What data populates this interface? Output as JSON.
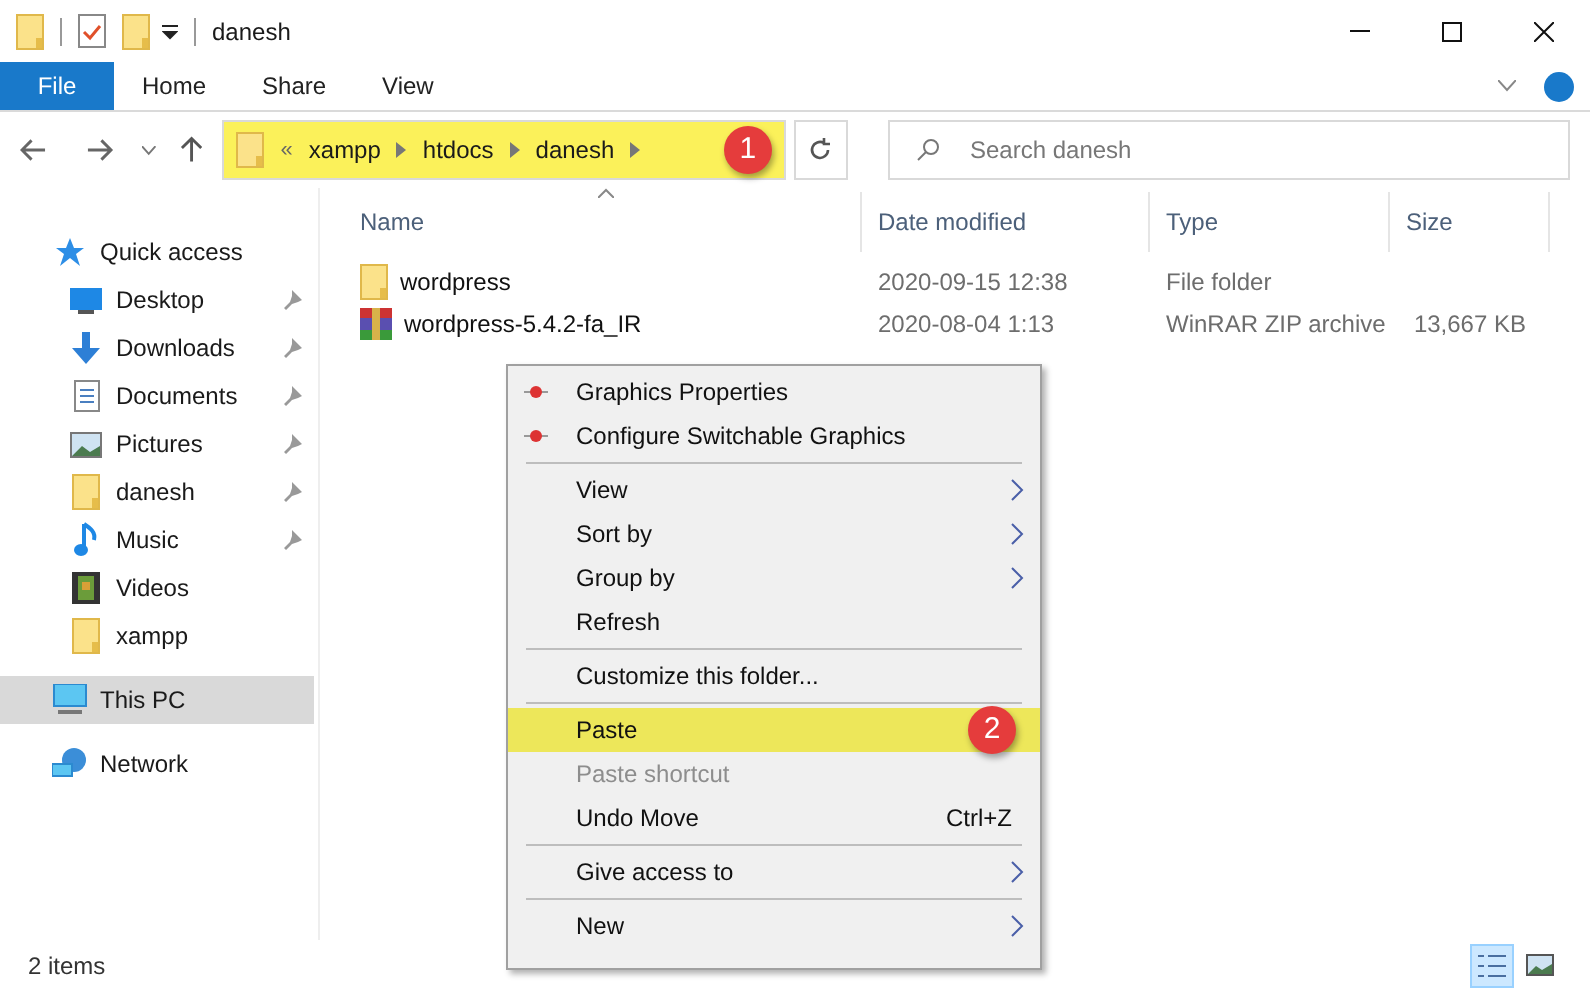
{
  "window": {
    "title": "danesh"
  },
  "ribbon_tabs": [
    {
      "label": "File",
      "selected": true
    },
    {
      "label": "Home",
      "selected": false
    },
    {
      "label": "Share",
      "selected": false
    },
    {
      "label": "View",
      "selected": false
    }
  ],
  "address": {
    "overflow": "«",
    "crumbs": [
      "xampp",
      "htdocs",
      "danesh"
    ],
    "highlighted": true,
    "badge": "1"
  },
  "search": {
    "placeholder": "Search danesh"
  },
  "sidebar": {
    "items": [
      {
        "label": "Quick access",
        "kind": "star",
        "pinned": false,
        "selected": false
      },
      {
        "label": "Desktop",
        "kind": "desktop",
        "pinned": true,
        "selected": false
      },
      {
        "label": "Downloads",
        "kind": "download",
        "pinned": true,
        "selected": false
      },
      {
        "label": "Documents",
        "kind": "document",
        "pinned": true,
        "selected": false
      },
      {
        "label": "Pictures",
        "kind": "pictures",
        "pinned": true,
        "selected": false
      },
      {
        "label": "danesh",
        "kind": "folder",
        "pinned": true,
        "selected": false
      },
      {
        "label": "Music",
        "kind": "music",
        "pinned": true,
        "selected": false
      },
      {
        "label": "Videos",
        "kind": "video",
        "pinned": false,
        "selected": false
      },
      {
        "label": "xampp",
        "kind": "folder",
        "pinned": false,
        "selected": false
      },
      {
        "label": "This PC",
        "kind": "pc",
        "pinned": false,
        "selected": true
      },
      {
        "label": "Network",
        "kind": "network",
        "pinned": false,
        "selected": false
      }
    ]
  },
  "table": {
    "columns": [
      "Name",
      "Date modified",
      "Type",
      "Size"
    ],
    "rows": [
      {
        "kind": "folder",
        "cells": [
          "wordpress",
          "2020-09-15 12:38",
          "File folder",
          ""
        ]
      },
      {
        "kind": "archive",
        "cells": [
          "wordpress-5.4.2-fa_IR",
          "2020-08-04 1:13",
          "WinRAR ZIP archive",
          "13,667 KB"
        ]
      }
    ]
  },
  "context_menu": {
    "groups": [
      [
        {
          "label": "Graphics Properties",
          "icon": true,
          "submenu": false,
          "disabled": false,
          "selected": false
        },
        {
          "label": "Configure Switchable Graphics",
          "icon": true,
          "submenu": false,
          "disabled": false,
          "selected": false
        }
      ],
      [
        {
          "label": "View",
          "submenu": true,
          "disabled": false,
          "selected": false
        },
        {
          "label": "Sort by",
          "submenu": true,
          "disabled": false,
          "selected": false
        },
        {
          "label": "Group by",
          "submenu": true,
          "disabled": false,
          "selected": false
        },
        {
          "label": "Refresh",
          "submenu": false,
          "disabled": false,
          "selected": false
        }
      ],
      [
        {
          "label": "Customize this folder...",
          "submenu": false,
          "disabled": false,
          "selected": false
        }
      ],
      [
        {
          "label": "Paste",
          "submenu": false,
          "disabled": false,
          "selected": true,
          "badge": "2"
        },
        {
          "label": "Paste shortcut",
          "submenu": false,
          "disabled": true,
          "selected": false
        },
        {
          "label": "Undo Move",
          "shortcut": "Ctrl+Z",
          "submenu": false,
          "disabled": false,
          "selected": false
        }
      ],
      [
        {
          "label": "Give access to",
          "submenu": true,
          "disabled": false,
          "selected": false
        }
      ],
      [
        {
          "label": "New",
          "submenu": true,
          "disabled": false,
          "selected": false
        }
      ]
    ]
  },
  "status_bar": {
    "text": "2 items",
    "views": [
      {
        "kind": "details",
        "selected": true
      },
      {
        "kind": "thumbnails",
        "selected": false
      }
    ]
  }
}
